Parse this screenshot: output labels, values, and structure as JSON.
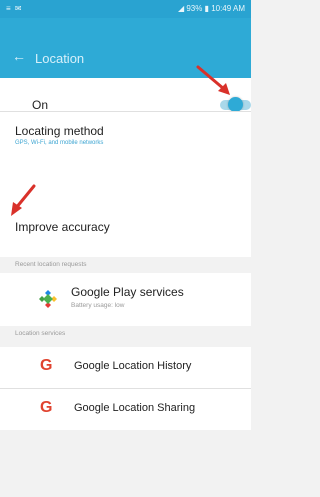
{
  "status_bar": {
    "left": "≡ ✉",
    "right": "◢ 93% ▮ 10:49 AM"
  },
  "app_bar": {
    "back_icon": "arrow-left",
    "title": "Location"
  },
  "master_switch": {
    "label": "On",
    "enabled": true,
    "accent": "#2eaad6"
  },
  "locating_method": {
    "label": "Locating method",
    "value": "GPS, Wi-Fi, and mobile networks"
  },
  "improve_accuracy": {
    "label": "Improve accuracy"
  },
  "sections": {
    "recent": "Recent location requests",
    "services": "Location services"
  },
  "recent_requests": [
    {
      "icon": "google-play-services-icon",
      "name": "Google Play services",
      "detail": "Battery usage: low"
    }
  ],
  "services": [
    {
      "icon": "google-g-icon",
      "glyph": "G",
      "name": "Google Location History"
    },
    {
      "icon": "google-g-icon",
      "glyph": "G",
      "name": "Google Location Sharing"
    }
  ],
  "annotation_color": "#d9312a"
}
